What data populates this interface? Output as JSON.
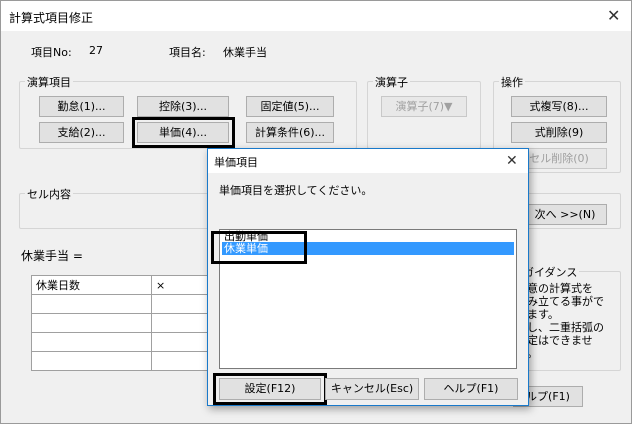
{
  "window": {
    "title": "計算式項目修正",
    "close_glyph": "✕"
  },
  "item_info": {
    "no_label": "項目No:",
    "no_value": "27",
    "name_label": "項目名:",
    "name_value": "休業手当"
  },
  "operand_group": {
    "label": "演算項目",
    "buttons": [
      "勤怠(1)...",
      "控除(3)...",
      "固定値(5)...",
      "支給(2)...",
      "単価(4)...",
      "計算条件(6)..."
    ]
  },
  "operator_group": {
    "label": "演算子",
    "button": "演算子(7)▼"
  },
  "operation_group": {
    "label": "操作",
    "buttons": [
      "式複写(8)...",
      "式削除(9)",
      "セル削除(0)"
    ]
  },
  "cell_group": {
    "label": "セル内容",
    "next_button": "次へ >>(N)"
  },
  "formula": {
    "label": "休業手当 ="
  },
  "grid": {
    "cell_1": "休業日数",
    "cell_2": "×"
  },
  "guidance": {
    "label": "ガイダンス",
    "lines": [
      "意の計算式を",
      "み立てる事がで",
      "ます。",
      "し、二重括弧の",
      "定はできませ",
      "。"
    ]
  },
  "help_button_partial": "ルプ(F1)",
  "dialog": {
    "title": "単価項目",
    "close_glyph": "✕",
    "instruction": "単価項目を選択してください。",
    "list": [
      "出勤単価",
      "休業単価"
    ],
    "selected_index": 1,
    "ok_button": "設定(F12)",
    "cancel_button": "キャンセル(Esc)",
    "help_button": "ヘルプ(F1)"
  }
}
